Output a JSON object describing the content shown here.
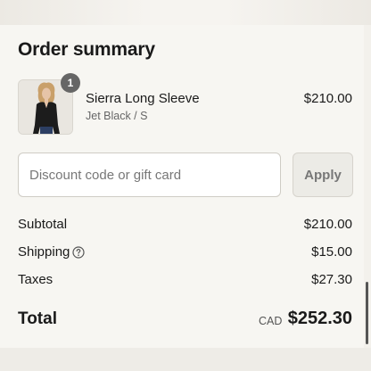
{
  "order_summary": {
    "title": "Order summary",
    "item": {
      "quantity_badge": "1",
      "name": "Sierra Long Sleeve",
      "variant": "Jet Black / S",
      "price": "$210.00"
    },
    "discount": {
      "placeholder": "Discount code or gift card",
      "value": "",
      "apply_label": "Apply"
    },
    "rows": {
      "subtotal": {
        "label": "Subtotal",
        "value": "$210.00"
      },
      "shipping": {
        "label": "Shipping",
        "value": "$15.00",
        "icon": "help-circle-icon"
      },
      "taxes": {
        "label": "Taxes",
        "value": "$27.30"
      }
    },
    "total": {
      "label": "Total",
      "currency": "CAD",
      "value": "$252.30"
    }
  },
  "colors": {
    "page_background": "#f7f6f2",
    "badge_background": "#666666",
    "apply_button_background": "#ecebe6",
    "text": "#1a1a1a"
  }
}
